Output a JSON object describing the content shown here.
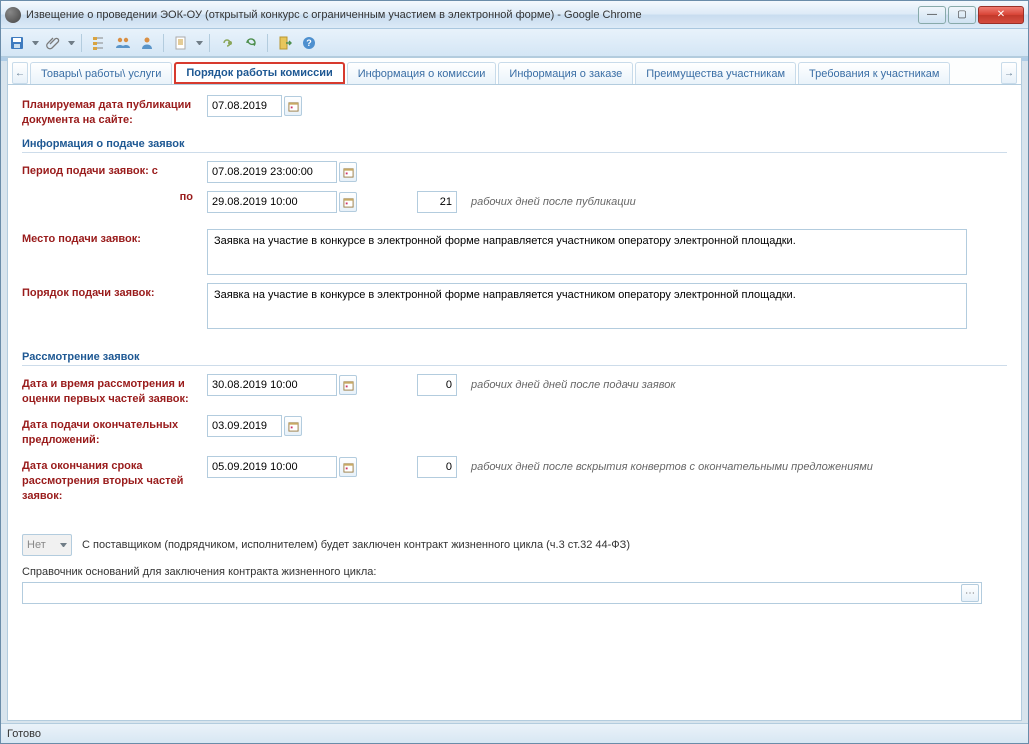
{
  "window": {
    "title": "Извещение о проведении ЭОК-ОУ (открытый конкурс с ограниченным участием в электронной форме) - Google Chrome"
  },
  "tabs": {
    "prev_arrow": "←",
    "next_arrow": "→",
    "items": [
      {
        "label": "Товары\\ работы\\ услуги"
      },
      {
        "label": "Порядок работы комиссии"
      },
      {
        "label": "Информация о комиссии"
      },
      {
        "label": "Информация о заказе"
      },
      {
        "label": "Преимущества участникам"
      },
      {
        "label": "Требования к участникам"
      }
    ],
    "active_index": 1
  },
  "form": {
    "planned_date": {
      "label": "Планируемая дата публикации документа на сайте:",
      "value": "07.08.2019"
    },
    "section1_title": "Информация о подаче заявок",
    "period_from": {
      "label": "Период подачи заявок: с",
      "value": "07.08.2019 23:00:00"
    },
    "period_to": {
      "label": "по",
      "value": "29.08.2019 10:00",
      "days": "21",
      "after": "рабочих дней после публикации"
    },
    "place": {
      "label": "Место подачи заявок:",
      "value": "Заявка на участие в конкурсе в электронной форме направляется участником оператору электронной площадки."
    },
    "order": {
      "label": "Порядок подачи заявок:",
      "value": "Заявка на участие в конкурсе в электронной форме направляется участником оператору электронной площадки."
    },
    "section2_title": "Рассмотрение заявок",
    "review_first": {
      "label": "Дата и время рассмотрения и оценки первых частей заявок:",
      "value": "30.08.2019 10:00",
      "days": "0",
      "after": "рабочих дней дней после подачи заявок"
    },
    "final_offer_date": {
      "label": "Дата подачи окончательных предложений:",
      "value": "03.09.2019"
    },
    "review_second": {
      "label": "Дата окончания срока рассмотрения вторых частей заявок:",
      "value": "05.09.2019 10:00",
      "days": "0",
      "after": "рабочих дней после вскрытия конвертов с окончательными предложениями"
    },
    "lifecycle": {
      "select_value": "Нет",
      "desc": "С поставщиком (подрядчиком, исполнителем) будет заключен контракт жизненного цикла (ч.3 ст.32 44-ФЗ)",
      "ref_label": "Справочник оснований для заключения контракта жизненного цикла:"
    }
  },
  "status": "Готово"
}
